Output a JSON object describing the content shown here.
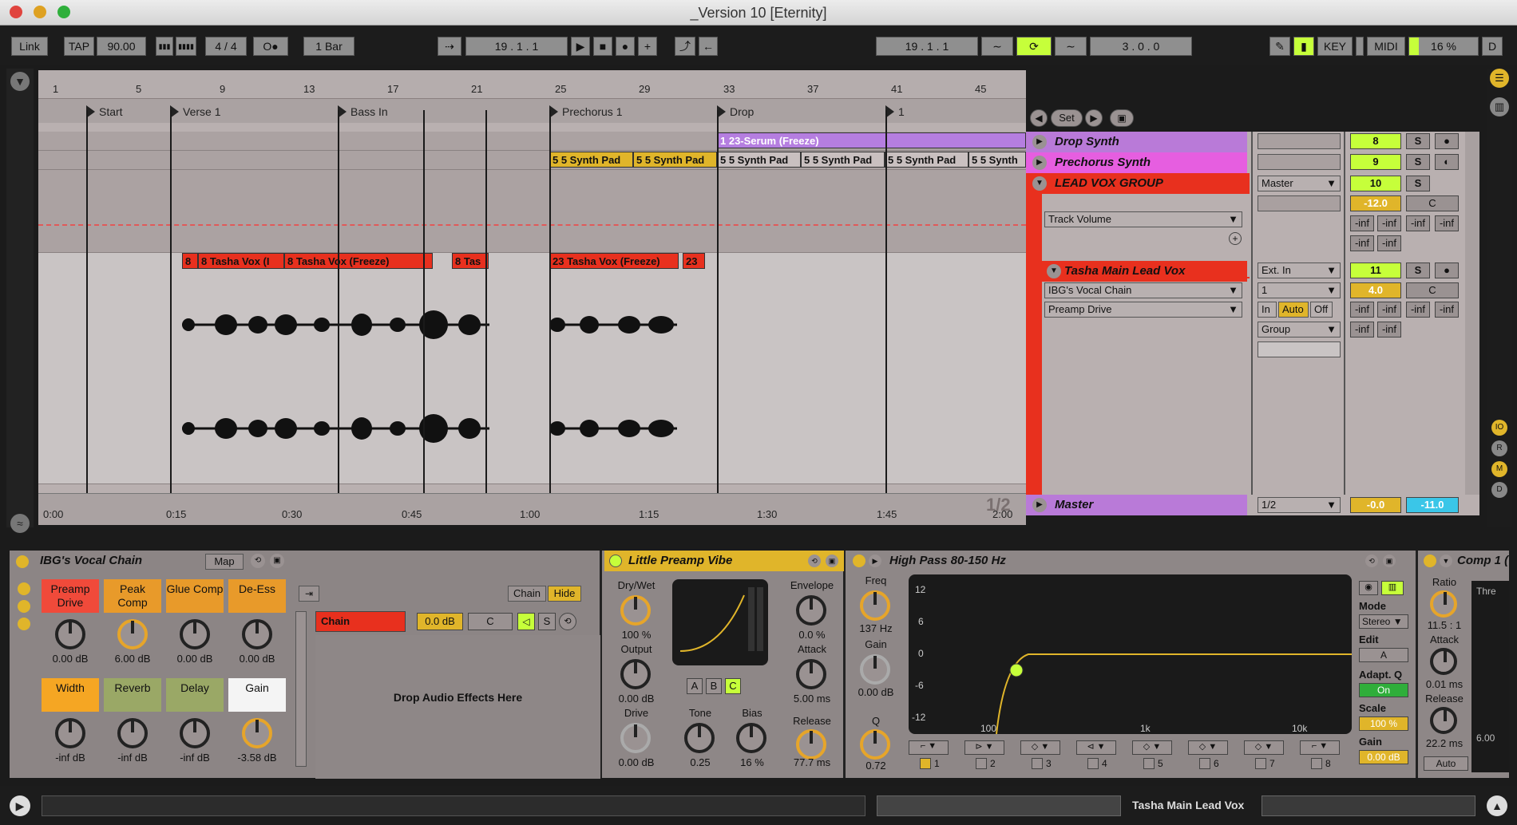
{
  "window": {
    "title": "_Version 10  [Eternity]"
  },
  "transport": {
    "link": "Link",
    "tap": "TAP",
    "tempo": "90.00",
    "nudge_down": "▮▮▮",
    "nudge_up": "▮▮▮▮",
    "signature": "4 / 4",
    "metro": "O●",
    "quant": "1 Bar",
    "position": "19 .  1 .  1",
    "loop_start": "19 .  1 .  1",
    "loop_length": "3 .  0 .  0",
    "key": "KEY",
    "midi": "MIDI",
    "cpu": "16 %",
    "d": "D"
  },
  "ruler": {
    "bars": [
      "1",
      "5",
      "9",
      "13",
      "17",
      "21",
      "25",
      "29",
      "33",
      "37",
      "41",
      "45"
    ]
  },
  "locators": [
    "Start",
    "Verse 1",
    "Bass In",
    "Prechorus 1",
    "Drop",
    "1"
  ],
  "timebar": [
    "0:00",
    "0:15",
    "0:30",
    "0:45",
    "1:00",
    "1:15",
    "1:30",
    "1:45",
    "2:00"
  ],
  "clips": {
    "serum": "1 23-Serum (Freeze)",
    "pads": [
      "5 5 Synth Pad",
      "5 5 Synth Pad",
      "5 5 Synth Pad",
      "5 5 Synth Pad",
      "5 5 Synth Pad",
      "5 5 Synth"
    ],
    "vox": [
      "8",
      "8 Tasha Vox (I",
      "8 Tasha Vox (Freeze)",
      "8 Tas",
      "23 Tasha Vox (Freeze)",
      "23"
    ]
  },
  "set_label": "Set",
  "tracks": [
    {
      "name": "Drop Synth",
      "num": "8",
      "color": "#b97ad8"
    },
    {
      "name": "Prechorus Synth",
      "num": "9",
      "color": "#e65ee0"
    },
    {
      "name": "LEAD VOX GROUP",
      "num": "10",
      "color": "#e8301e",
      "route": "Master",
      "vol": "-12.0",
      "pan": "C",
      "auto": "Track Volume"
    },
    {
      "name": "Tasha Main Lead Vox",
      "num": "11",
      "color": "#e8301e",
      "route": "Ext. In",
      "input": "1",
      "vol": "4.0",
      "pan": "C",
      "chain": "IBG's Vocal Chain",
      "param": "Preamp Drive",
      "out": "Group"
    }
  ],
  "monitor": {
    "in": "In",
    "auto": "Auto",
    "off": "Off"
  },
  "solo": "S",
  "inf": "-inf",
  "master": {
    "name": "Master",
    "route": "1/2",
    "page": "1/2",
    "vol": "-0.0",
    "pan": "-11.0"
  },
  "rack": {
    "title": "IBG's Vocal Chain",
    "map": "Map",
    "macros": [
      {
        "name": "Preamp Drive",
        "value": "0.00 dB",
        "color": "#f04a3a"
      },
      {
        "name": "Peak Comp",
        "value": "6.00 dB",
        "color": "#e89a2a"
      },
      {
        "name": "Glue Comp",
        "value": "0.00 dB",
        "color": "#e89a2a"
      },
      {
        "name": "De-Ess",
        "value": "0.00 dB",
        "color": "#e89a2a"
      },
      {
        "name": "Width",
        "value": "-inf dB",
        "color": "#f5a623"
      },
      {
        "name": "Reverb",
        "value": "-inf dB",
        "color": "#9aa866"
      },
      {
        "name": "Delay",
        "value": "-inf dB",
        "color": "#9aa866"
      },
      {
        "name": "Gain",
        "value": "-3.58 dB",
        "color": "#f4f4f4"
      }
    ],
    "chain_btn": "Chain",
    "hide_btn": "Hide",
    "chain_name": "Chain",
    "chain_vol": "0.0 dB",
    "chain_pan": "C",
    "drop_text": "Drop Audio Effects Here"
  },
  "preamp": {
    "title": "Little Preamp Vibe",
    "drywet_lbl": "Dry/Wet",
    "drywet": "100 %",
    "output_lbl": "Output",
    "output": "0.00 dB",
    "drive_lbl": "Drive",
    "drive": "0.00 dB",
    "tone_lbl": "Tone",
    "tone": "0.25",
    "bias_lbl": "Bias",
    "bias": "16 %",
    "env_lbl": "Envelope",
    "env": "0.0 %",
    "attack_lbl": "Attack",
    "attack": "5.00 ms",
    "release_lbl": "Release",
    "release": "77.7 ms",
    "a": "A",
    "b": "B",
    "c": "C"
  },
  "eq": {
    "title": "High Pass 80-150 Hz",
    "freq_lbl": "Freq",
    "freq": "137 Hz",
    "gain_lbl": "Gain",
    "gain": "0.00 dB",
    "q_lbl": "Q",
    "q": "0.72",
    "db_labels": [
      "12",
      "6",
      "0",
      "-6",
      "-12"
    ],
    "hz_labels": [
      "100",
      "1k",
      "10k"
    ],
    "mode_lbl": "Mode",
    "mode": "Stereo",
    "edit_lbl": "Edit",
    "edit": "A",
    "adaptq_lbl": "Adapt. Q",
    "adaptq": "On",
    "scale_lbl": "Scale",
    "scale": "100 %",
    "gainout_lbl": "Gain",
    "gainout": "0.00 dB",
    "bands": [
      "1",
      "2",
      "3",
      "4",
      "5",
      "6",
      "7",
      "8"
    ]
  },
  "comp": {
    "title": "Comp 1 (",
    "ratio_lbl": "Ratio",
    "ratio": "11.5 : 1",
    "attack_lbl": "Attack",
    "attack": "0.01 ms",
    "release_lbl": "Release",
    "release": "22.2 ms",
    "auto": "Auto",
    "thresh": "Thre",
    "val": "6.00"
  },
  "statusbar": {
    "track": "Tasha Main Lead Vox"
  },
  "colors": {
    "accent": "#c6ff3a",
    "group": "#e8301e",
    "clip_yellow": "#e0b52a"
  }
}
